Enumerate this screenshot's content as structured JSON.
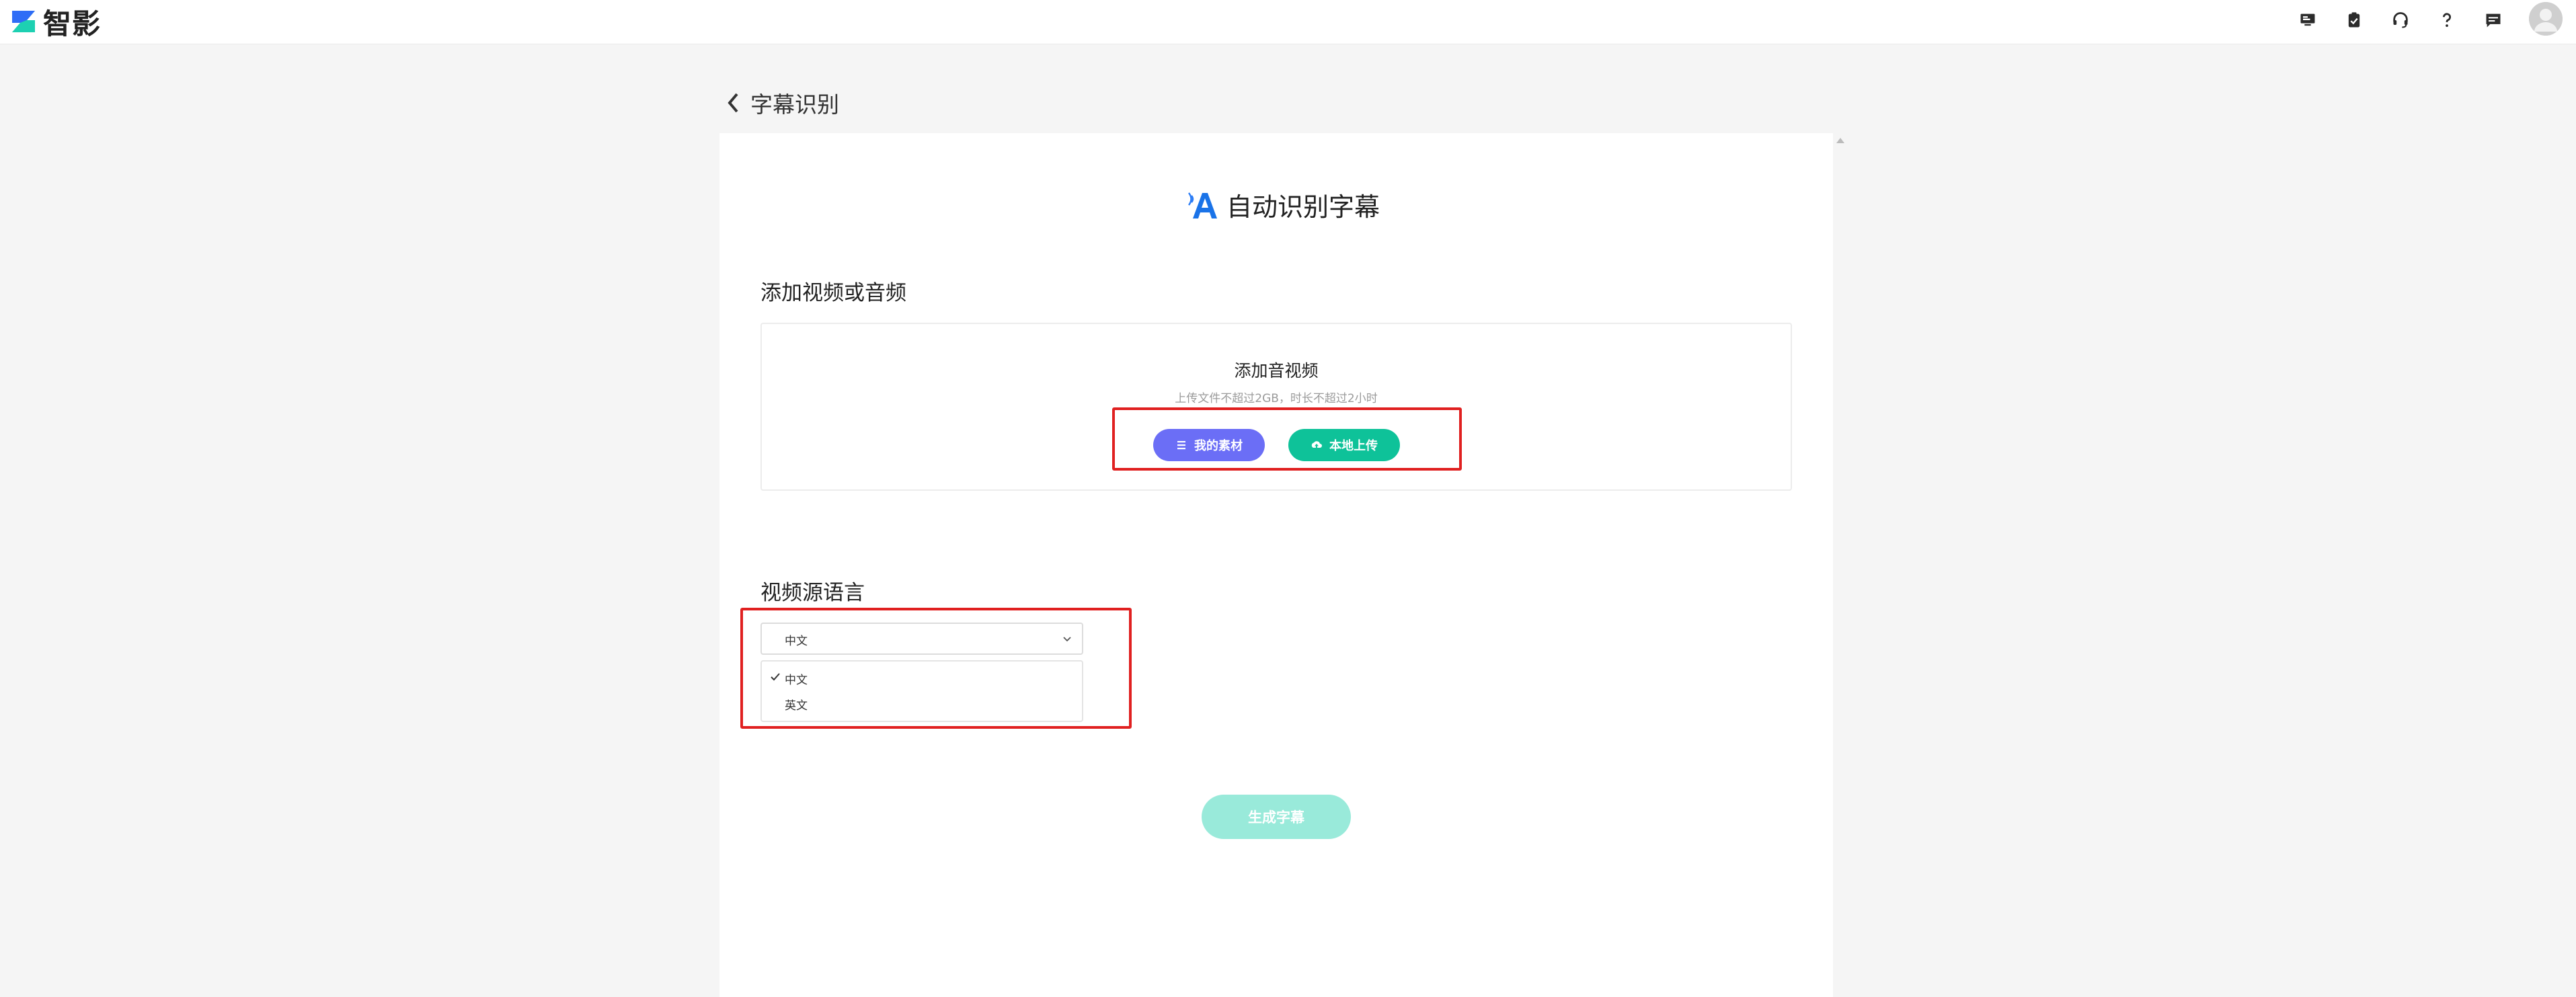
{
  "app": {
    "name": "智影"
  },
  "topbar": {
    "icons": [
      "monitor-icon",
      "clipboard-icon",
      "headset-icon",
      "help-icon",
      "message-icon",
      "avatar"
    ]
  },
  "header": {
    "back_title": "字幕识别"
  },
  "card": {
    "title": "自动识别字幕"
  },
  "upload": {
    "section_label": "添加视频或音频",
    "box_title": "添加音视频",
    "hint": "上传文件不超过2GB，时长不超过2小时",
    "my_materials_label": "我的素材",
    "local_upload_label": "本地上传"
  },
  "language": {
    "section_label": "视频源语言",
    "selected": "中文",
    "options": [
      {
        "label": "中文",
        "checked": true
      },
      {
        "label": "英文",
        "checked": false
      }
    ]
  },
  "generate_button_label": "生成字幕",
  "colors": {
    "accent_green": "#0ec299",
    "accent_purple": "#6b6ef6",
    "highlight_red": "#e02020",
    "disabled_green": "#99eada"
  }
}
